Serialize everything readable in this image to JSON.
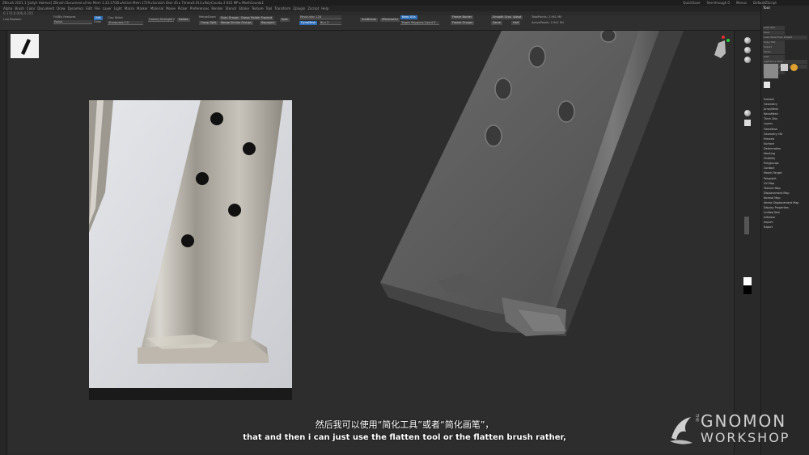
{
  "window": {
    "title": "ZBrush 2021.1 [Jodyh Holmes]   ZBrush Document   ▸Free Mem 1.33.17GB ▸Active Mem 1729 ▸Scratch Disk 45 ▸ Timer▸0.013 ▸PolyCount▸ 2.941 MP ▸ MeshCount▸1",
    "right_items": [
      "QuickSave",
      "See-through 0",
      "Menus",
      "DefaultZScript"
    ]
  },
  "menus": [
    "Alpha",
    "Brush",
    "Color",
    "Document",
    "Draw",
    "Dynamics",
    "Edit",
    "File",
    "Layer",
    "Light",
    "Macro",
    "Marker",
    "Material",
    "Movie",
    "Picker",
    "Preferences",
    "Render",
    "Stencil",
    "Stroke",
    "Texture",
    "Tool",
    "Transform",
    "Zplugin",
    "Zscript",
    "Help"
  ],
  "coords": "0.170,0.006,0.150",
  "toolbar": {
    "lazy_label": "Live Boolean",
    "lazy2": "",
    "stroke_items": [
      "Fill/Bly Features",
      "Colorize",
      "Push"
    ],
    "polish_label": "Polish",
    "btn_edit": "Edit",
    "btn_draw": "Draw",
    "btn_move": "Move",
    "btn_scale": "Scale",
    "btn_rotate": "Rotate",
    "clay_label": "Clay Polish",
    "sharpness_label": "Sharpness",
    "sharpness_value": "0.5",
    "smooth_label": "Smooth",
    "smooth_value": "8",
    "gravity_label": "Gravity Strength",
    "gravity_value": "0",
    "delete_label": "Delete",
    "merge_label": "MergeDown",
    "nrm_label": "Scan Groups",
    "group_label": "Merge Similar Groups",
    "group_split": "Group Split",
    "group_visible": "Group Visible",
    "group_edit": "Expand",
    "reproject": "Reproject",
    "split": "Split",
    "remesh_label": "Remesh",
    "dynamesh_label": "DynaMesh",
    "resolution_label": "Resolution",
    "resolution_value": "128",
    "blur_label": "Blur",
    "blur_value": "2",
    "subdiv_label": "SubDivide",
    "zremesher_label": "ZRemesher",
    "keep_label": "Keep UVs",
    "target_label": "Target Polygons Count",
    "target_value": "5",
    "halfd_label": "Half",
    "adapt": "Adapt",
    "freeze": "Freeze Border",
    "freeze_groups": "Freeze Groups",
    "smooth_groups": "Smooth Groups",
    "same": "Same",
    "total_points": "TotalPoints: 2.941 Mil",
    "active_points": "ActivePoints: 2.941 Mil"
  },
  "tray": {
    "title": "Tool",
    "rows": [
      [
        "Load Tool",
        "Save As"
      ],
      [
        "Save",
        "Save Gear"
      ],
      [
        "Load Tools From Project",
        ""
      ],
      [
        "Copy Tool",
        "Paste Tool"
      ],
      [
        "Import",
        "Export"
      ],
      [
        "Clone",
        "Make PolyMesh3D"
      ],
      [
        "GoZ",
        "All"
      ],
      [
        "Lightbox ▸ Tools",
        ""
      ],
      [
        "PM3D_Pistol_48",
        ""
      ]
    ],
    "submenu": [
      "Subtool",
      "Geometry",
      "ArrayMesh",
      "NanoMesh",
      "Thick Skin",
      "Layers",
      "FiberMesh",
      "Geometry HD",
      "Preview",
      "Surface",
      "Deformation",
      "Masking",
      "Visibility",
      "Polygroups",
      "Contact",
      "Morph Target",
      "Polypaint",
      "UV Map",
      "Texture Map",
      "Displacement Map",
      "Normal Map",
      "Vector Displacement Map",
      "Display Properties",
      "Unified Skin",
      "Initialize",
      "Import",
      "Export"
    ]
  },
  "subtitle": {
    "cn": "然后我可以使用“简化工具”或者“简化画笔”，",
    "en": "that and then i can just use the flatten tool or the flatten brush rather,"
  },
  "logo": {
    "top": "GNOMON",
    "bottom": "WORKSHOP",
    "the": "THE"
  },
  "colors": {
    "accent": "#2f6fb8",
    "viewport_bg": "#2d2d2d",
    "panel": "#2f2f2f"
  }
}
